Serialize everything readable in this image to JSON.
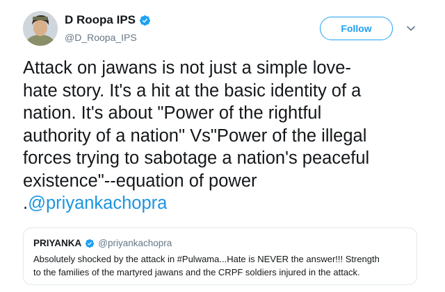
{
  "author": {
    "display_name": "D Roopa IPS",
    "username": "@D_Roopa_IPS"
  },
  "actions": {
    "follow_label": "Follow"
  },
  "tweet": {
    "text_lines": [
      "Attack on jawans is not just a simple love-",
      "hate story. It's a hit at the basic identity of a",
      "nation. It's about \"Power of the rightful",
      "authority of a nation\" Vs\"Power of the illegal",
      "forces trying to sabotage a nation's peaceful",
      "existence\"--equation of power"
    ],
    "mention_prefix": ".",
    "mention": "@priyankachopra"
  },
  "quoted_tweet": {
    "display_name": "PRIYANKA",
    "username": "@priyankachopra",
    "text_lines": [
      "Absolutely shocked by the attack in #Pulwama...Hate is NEVER the answer!!! Strength",
      "to the families of the martyred jawans and the CRPF soldiers injured in the attack."
    ]
  },
  "colors": {
    "accent": "#1da1f2",
    "link": "#1b95e0",
    "secondary_text": "#657786",
    "border": "#e1e8ed"
  }
}
